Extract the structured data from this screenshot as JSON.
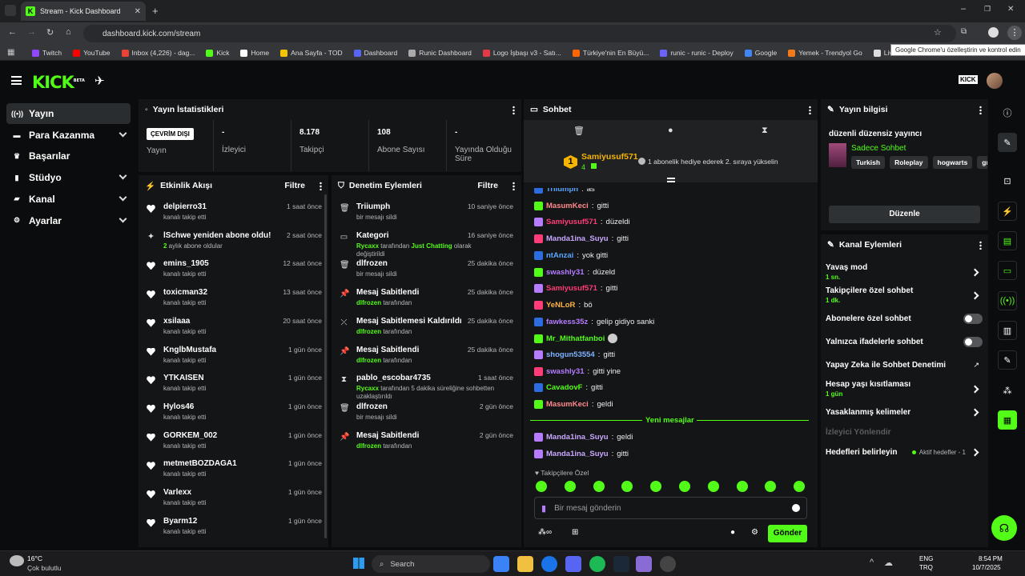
{
  "browser": {
    "tab_title": "Stream - Kick Dashboard",
    "url": "dashboard.kick.com/stream",
    "tooltip": "Google Chrome'u özelleştirin ve kontrol edin",
    "bookmarks": [
      {
        "label": "Twitch",
        "color": "#9146ff"
      },
      {
        "label": "YouTube",
        "color": "#ff0000"
      },
      {
        "label": "Inbox (4,226) - dag...",
        "color": "#ea4335"
      },
      {
        "label": "Kick",
        "color": "#53fc18"
      },
      {
        "label": "Home",
        "color": "#ffffff"
      },
      {
        "label": "Ana Sayfa - TOD",
        "color": "#f5c400"
      },
      {
        "label": "Dashboard",
        "color": "#5865f2"
      },
      {
        "label": "Runic Dashboard",
        "color": "#aaaaaa"
      },
      {
        "label": "Logo İşbaşı v3 - Satı...",
        "color": "#e63946"
      },
      {
        "label": "Türkiye'nin En Büyü...",
        "color": "#ff6600"
      },
      {
        "label": "runic - runic - Deploy",
        "color": "#6c63ff"
      },
      {
        "label": "Google",
        "color": "#4285f4"
      },
      {
        "label": "Yemek - Trendyol Go",
        "color": "#f27a1a"
      },
      {
        "label": "Livad For Streamers",
        "color": "#dddddd"
      }
    ]
  },
  "brand": {
    "logo": "KICK",
    "beta": "BETA"
  },
  "sidebar": [
    {
      "label": "Yayın",
      "icon": "broadcast-icon",
      "active": true
    },
    {
      "label": "Para Kazanma",
      "icon": "money-icon",
      "chevron": true
    },
    {
      "label": "Başarılar",
      "icon": "trophy-icon"
    },
    {
      "label": "Stüdyo",
      "icon": "studio-icon",
      "chevron": true
    },
    {
      "label": "Kanal",
      "icon": "channel-icon",
      "chevron": true
    },
    {
      "label": "Ayarlar",
      "icon": "gear-icon",
      "chevron": true
    }
  ],
  "stats": {
    "title": "Yayın İstatistikleri",
    "status": "ÇEVRİM DIŞI",
    "status_label": "Yayın",
    "cells": [
      {
        "value": "-",
        "label": "İzleyici"
      },
      {
        "value": "8.178",
        "label": "Takipçi"
      },
      {
        "value": "108",
        "label": "Abone Sayısı"
      },
      {
        "value": "-",
        "label": "Yayında Olduğu Süre"
      }
    ]
  },
  "activity": {
    "title": "Etkinlik Akışı",
    "filter": "Filtre",
    "items": [
      {
        "name": "delpierro31",
        "sub": "kanalı takip etti",
        "time": "1 saat önce",
        "type": "follow"
      },
      {
        "name": "lSchwe yeniden abone oldu!",
        "sub_hl": "2",
        "sub": " aylık abone oldular",
        "time": "2 saat önce",
        "type": "sub"
      },
      {
        "name": "emins_1905",
        "sub": "kanalı takip etti",
        "time": "12 saat önce",
        "type": "follow"
      },
      {
        "name": "toxicman32",
        "sub": "kanalı takip etti",
        "time": "13 saat önce",
        "type": "follow"
      },
      {
        "name": "xsilaaa",
        "sub": "kanalı takip etti",
        "time": "20 saat önce",
        "type": "follow"
      },
      {
        "name": "KnglbMustafa",
        "sub": "kanalı takip etti",
        "time": "1 gün önce",
        "type": "follow"
      },
      {
        "name": "YTKAISEN",
        "sub": "kanalı takip etti",
        "time": "1 gün önce",
        "type": "follow"
      },
      {
        "name": "Hylos46",
        "sub": "kanalı takip etti",
        "time": "1 gün önce",
        "type": "follow"
      },
      {
        "name": "GORKEM_002",
        "sub": "kanalı takip etti",
        "time": "1 gün önce",
        "type": "follow"
      },
      {
        "name": "metmetBOZDAGA1",
        "sub": "kanalı takip etti",
        "time": "1 gün önce",
        "type": "follow"
      },
      {
        "name": "Varlexx",
        "sub": "kanalı takip etti",
        "time": "1 gün önce",
        "type": "follow"
      },
      {
        "name": "Byarm12",
        "sub": "kanalı takip etti",
        "time": "1 gün önce",
        "type": "follow"
      }
    ]
  },
  "moderation": {
    "title": "Denetim Eylemleri",
    "filter": "Filtre",
    "items": [
      {
        "name": "Triiumph",
        "sub": "bir mesajı sildi",
        "time": "10 saniye önce",
        "icon": "🗑"
      },
      {
        "name": "Kategori",
        "hl": "Rycaxx",
        "sub": " tarafından ",
        "hl2": "Just Chatting",
        "sub2": " olarak değiştirildi",
        "time": "16 saniye önce",
        "icon": "▭"
      },
      {
        "name": "dlfrozen",
        "sub": "bir mesajı sildi",
        "time": "25 dakika önce",
        "icon": "🗑"
      },
      {
        "name": "Mesaj Sabitlendi",
        "hl": "dlfrozen",
        "sub": " tarafından",
        "time": "25 dakika önce",
        "icon": "📌"
      },
      {
        "name": "Mesaj Sabitlemesi Kaldırıldı",
        "hl": "dlfrozen",
        "sub": " tarafından",
        "time": "25 dakika önce",
        "icon": "⤫"
      },
      {
        "name": "Mesaj Sabitlendi",
        "hl": "dlfrozen",
        "sub": " tarafından",
        "time": "25 dakika önce",
        "icon": "📌"
      },
      {
        "name": "pablo_escobar4735",
        "hl": "Rycaxx",
        "sub": " tarafından 5 dakika süreliğine sohbetten uzaklaştırıldı",
        "time": "1 saat önce",
        "icon": "⧗"
      },
      {
        "name": "dlfrozen",
        "sub": "bir mesajı sildi",
        "time": "2 gün önce",
        "icon": "🗑"
      },
      {
        "name": "Mesaj Sabitlendi",
        "hl": "dlfrozen",
        "sub": " tarafından",
        "time": "2 gün önce",
        "icon": "📌"
      }
    ]
  },
  "chat": {
    "title": "Sohbet",
    "pinned_user": "Samiyusuf571",
    "pinned_count": "4",
    "pinned_msg": "1 abonelik hediye ederek 2. sıraya yükselin",
    "messages": [
      {
        "user": "Triiumph",
        "color": "#5aa7ff",
        "text": "as"
      },
      {
        "user": "MasumKeci",
        "color": "#ff8a8a",
        "text": "gitti"
      },
      {
        "user": "Samiyusuf571",
        "color": "#ff3c78",
        "text": "düzeldi"
      },
      {
        "user": "Manda1ina_Suyu",
        "color": "#c9a7ff",
        "text": "gitti"
      },
      {
        "user": "ntAnzai",
        "color": "#5aa7ff",
        "text": "yok gitti"
      },
      {
        "user": "swashly31",
        "color": "#b57cff",
        "text": "düzeld"
      },
      {
        "user": "Samiyusuf571",
        "color": "#ff3c78",
        "text": "gitti"
      },
      {
        "user": "YeNLoR",
        "color": "#ffb347",
        "text": "bö"
      },
      {
        "user": "fawkess35z",
        "color": "#b57cff",
        "text": "gelip gidiyo sanki"
      },
      {
        "user": "Mr_Mithatfanboi",
        "color": "#53fc18",
        "text": ""
      },
      {
        "user": "shogun53554",
        "color": "#7fb3ff",
        "text": "gitti"
      },
      {
        "user": "swashly31",
        "color": "#b57cff",
        "text": "gitti yine"
      },
      {
        "user": "CavadovF",
        "color": "#53fc18",
        "text": "gitti"
      },
      {
        "user": "MasumKeci",
        "color": "#ff8a8a",
        "text": "geldi"
      }
    ],
    "new_label": "Yeni mesajlar",
    "new_messages": [
      {
        "user": "Manda1ina_Suyu",
        "color": "#c9a7ff",
        "text": "geldi"
      },
      {
        "user": "Manda1ina_Suyu",
        "color": "#c9a7ff",
        "text": "gitti"
      }
    ],
    "followers_only": "Takipçilere Özel",
    "placeholder": "Bir mesaj gönderin",
    "send": "Gönder"
  },
  "info": {
    "title": "Yayın bilgisi",
    "stream_title": "düzenli düzensiz yayıncı",
    "category": "Sadece Sohbet",
    "tags": [
      "Turkish",
      "Roleplay",
      "hogwarts",
      "gm"
    ],
    "edit": "Düzenle"
  },
  "channel_actions": {
    "title": "Kanal Eylemleri",
    "items": [
      {
        "label": "Yavaş mod",
        "sub": "1 sn.",
        "ctl": "arrow"
      },
      {
        "label": "Takipçilere özel sohbet",
        "sub": "1 dk.",
        "ctl": "arrow"
      },
      {
        "label": "Abonelere özel sohbet",
        "sub": "",
        "ctl": "toggle"
      },
      {
        "label": "Yalnızca ifadelerle sohbet",
        "sub": "",
        "ctl": "toggle"
      },
      {
        "label": "Yapay Zeka ile Sohbet Denetimi",
        "sub": "",
        "ctl": "ext"
      },
      {
        "label": "Hesap yaşı kısıtlaması",
        "sub": "1 gün",
        "ctl": "arrow"
      },
      {
        "label": "Yasaklanmış kelimeler",
        "sub": "",
        "ctl": "arrow"
      },
      {
        "label": "İzleyici Yönlendir",
        "sub": "",
        "ctl": "none",
        "disabled": true
      },
      {
        "label": "Hedefleri belirleyin",
        "sub": "",
        "ctl": "goal",
        "goal": "Aktif hedefler - 1"
      }
    ]
  },
  "taskbar": {
    "weather_temp": "16°C",
    "weather_text": "Çok bulutlu",
    "search": "Search",
    "lang1": "ENG",
    "lang2": "TRQ",
    "time": "8:54 PM",
    "date": "10/7/2025"
  }
}
